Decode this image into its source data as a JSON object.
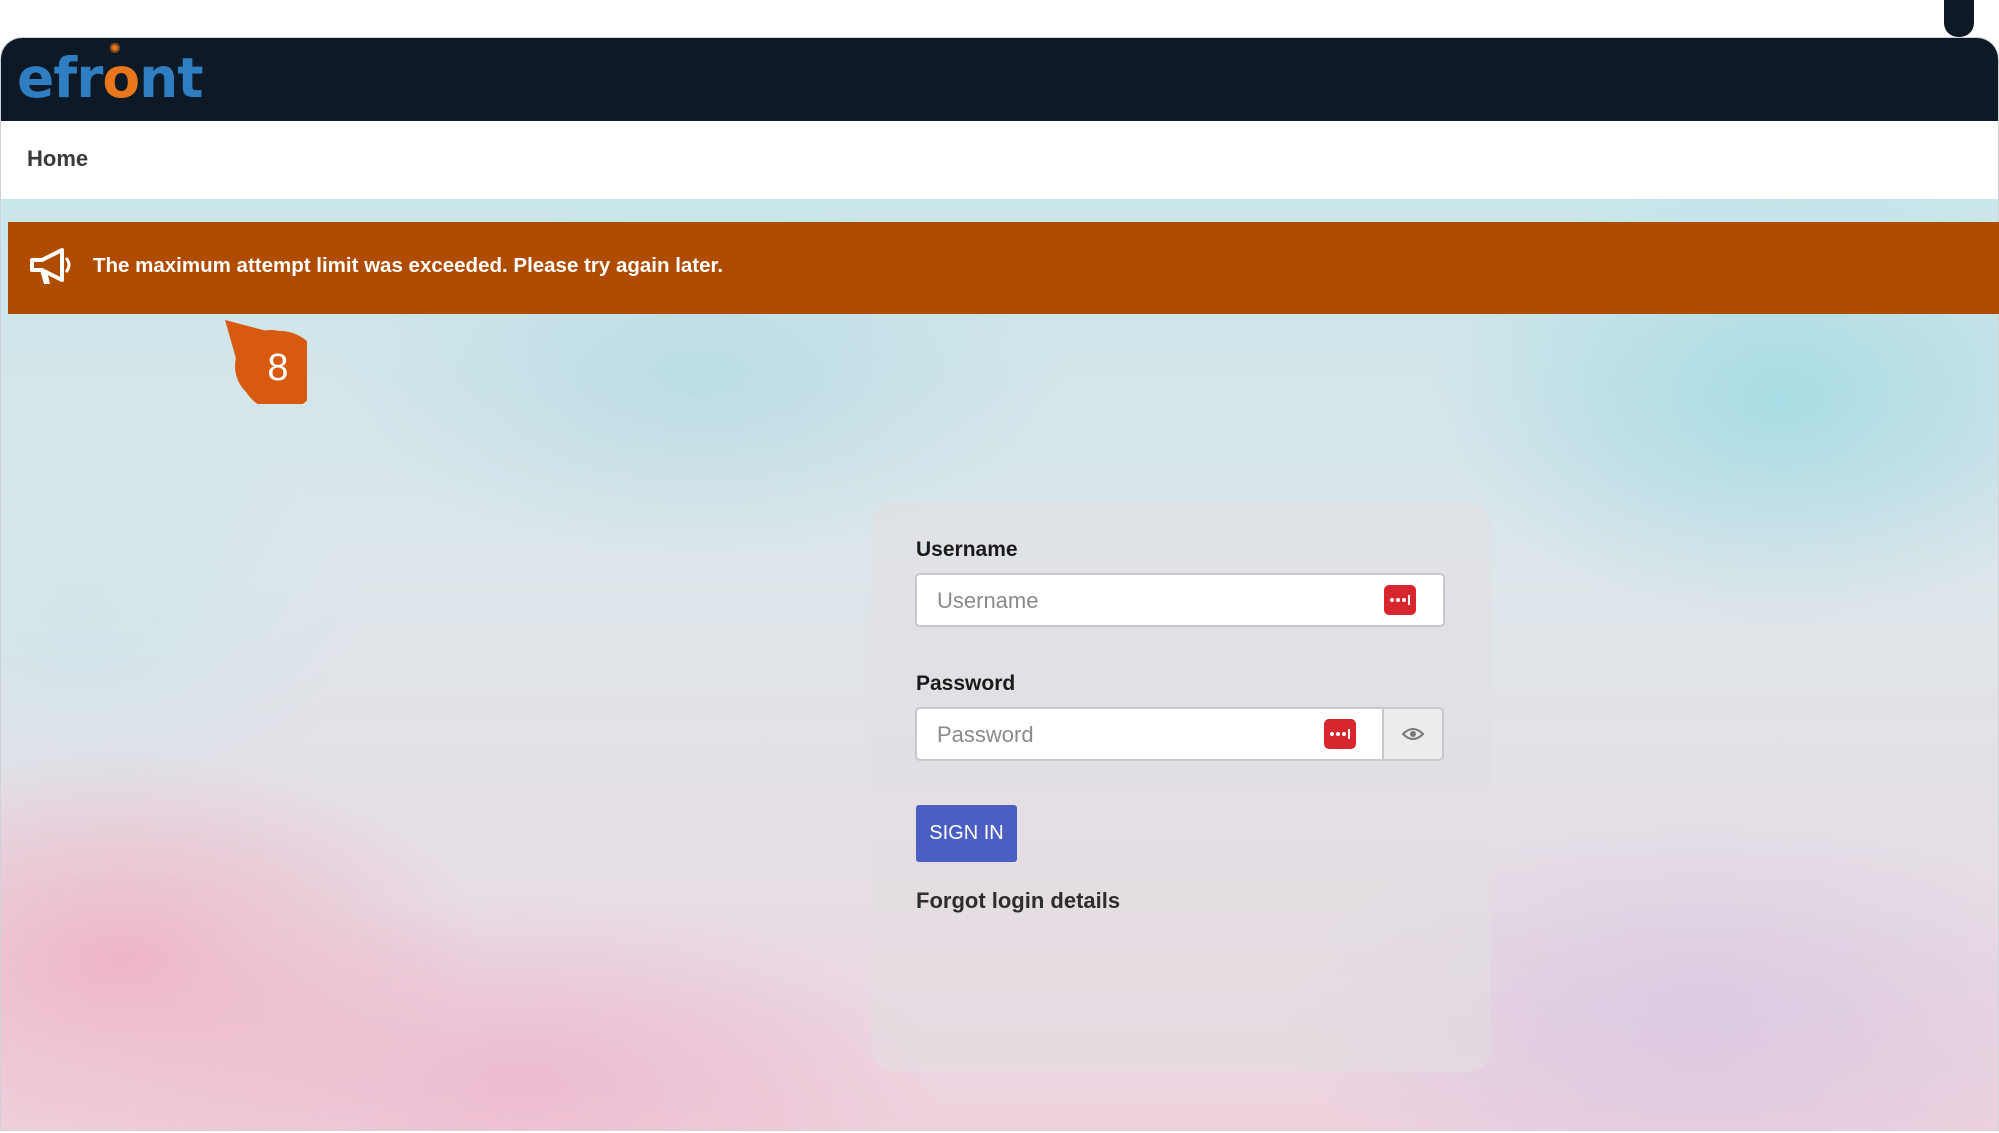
{
  "app": {
    "logo_text": "efront"
  },
  "nav": {
    "home_label": "Home"
  },
  "alert": {
    "message": "The maximum attempt limit was exceeded. Please try again later.",
    "icon": "megaphone-icon",
    "color": "#b04c00"
  },
  "step_badge": {
    "number": "8",
    "color": "#d85a10"
  },
  "login": {
    "username_label": "Username",
    "username_placeholder": "Username",
    "username_value": "",
    "password_label": "Password",
    "password_placeholder": "Password",
    "password_value": "",
    "sign_in_label": "SIGN IN",
    "forgot_label": "Forgot login details",
    "accent_color": "#4a5fc1"
  }
}
